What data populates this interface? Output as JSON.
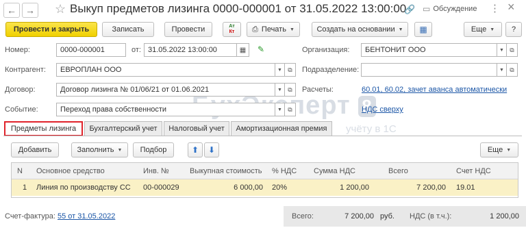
{
  "window": {
    "title": "Выкуп предметов лизинга 0000-000001 от 31.05.2022 13:00:00",
    "discussion_label": "Обсуждение",
    "more_icon": "⋮",
    "close_icon": "×"
  },
  "toolbar": {
    "post_and_close": "Провести и закрыть",
    "save": "Записать",
    "post": "Провести",
    "print": "Печать",
    "create_based_on": "Создать на основании",
    "more": "Еще",
    "help": "?",
    "dt_kt_icon_text": "Дт Кт"
  },
  "form": {
    "number_label": "Номер:",
    "number_value": "0000-000001",
    "date_prefix": "от:",
    "date_value": "31.05.2022 13:00:00",
    "organization_label": "Организация:",
    "organization_value": "БЕНТОНИТ ООО",
    "counterparty_label": "Контрагент:",
    "counterparty_value": "ЕВРОПЛАН ООО",
    "division_label": "Подразделение:",
    "division_value": "",
    "contract_label": "Договор:",
    "contract_value": "Договор лизинга № 01/06/21 от 01.06.2021",
    "settlements_label": "Расчеты:",
    "settlements_link": "60.01, 60.02, зачет аванса автоматически",
    "event_label": "Событие:",
    "event_value": "Переход права собственности",
    "vat_link": "НДС сверху"
  },
  "watermark": {
    "main": "БухЭксперт",
    "number": "8",
    "sub": "учёту в 1С"
  },
  "tabs": [
    {
      "label": "Предметы лизинга"
    },
    {
      "label": "Бухгалтерский учет"
    },
    {
      "label": "Налоговый учет"
    },
    {
      "label": "Амортизационная премия"
    }
  ],
  "table_toolbar": {
    "add": "Добавить",
    "fill": "Заполнить",
    "select": "Подбор",
    "more": "Еще"
  },
  "table": {
    "headers": [
      "N",
      "Основное средство",
      "Инв. №",
      "Выкупная стоимость",
      "% НДС",
      "Сумма НДС",
      "Всего",
      "Счет НДС"
    ],
    "rows": [
      {
        "n": "1",
        "asset": "Линия по производству СС",
        "inv": "00-000029",
        "price": "6 000,00",
        "vat_rate": "20%",
        "vat_sum": "1 200,00",
        "total": "7 200,00",
        "vat_account": "19.01"
      }
    ]
  },
  "footer": {
    "invoice_label": "Счет-фактура:",
    "invoice_link": "55 от 31.05.2022",
    "total_label": "Всего:",
    "total_value": "7 200,00",
    "currency": "руб.",
    "vat_label": "НДС (в т.ч.):",
    "vat_value": "1 200,00"
  }
}
